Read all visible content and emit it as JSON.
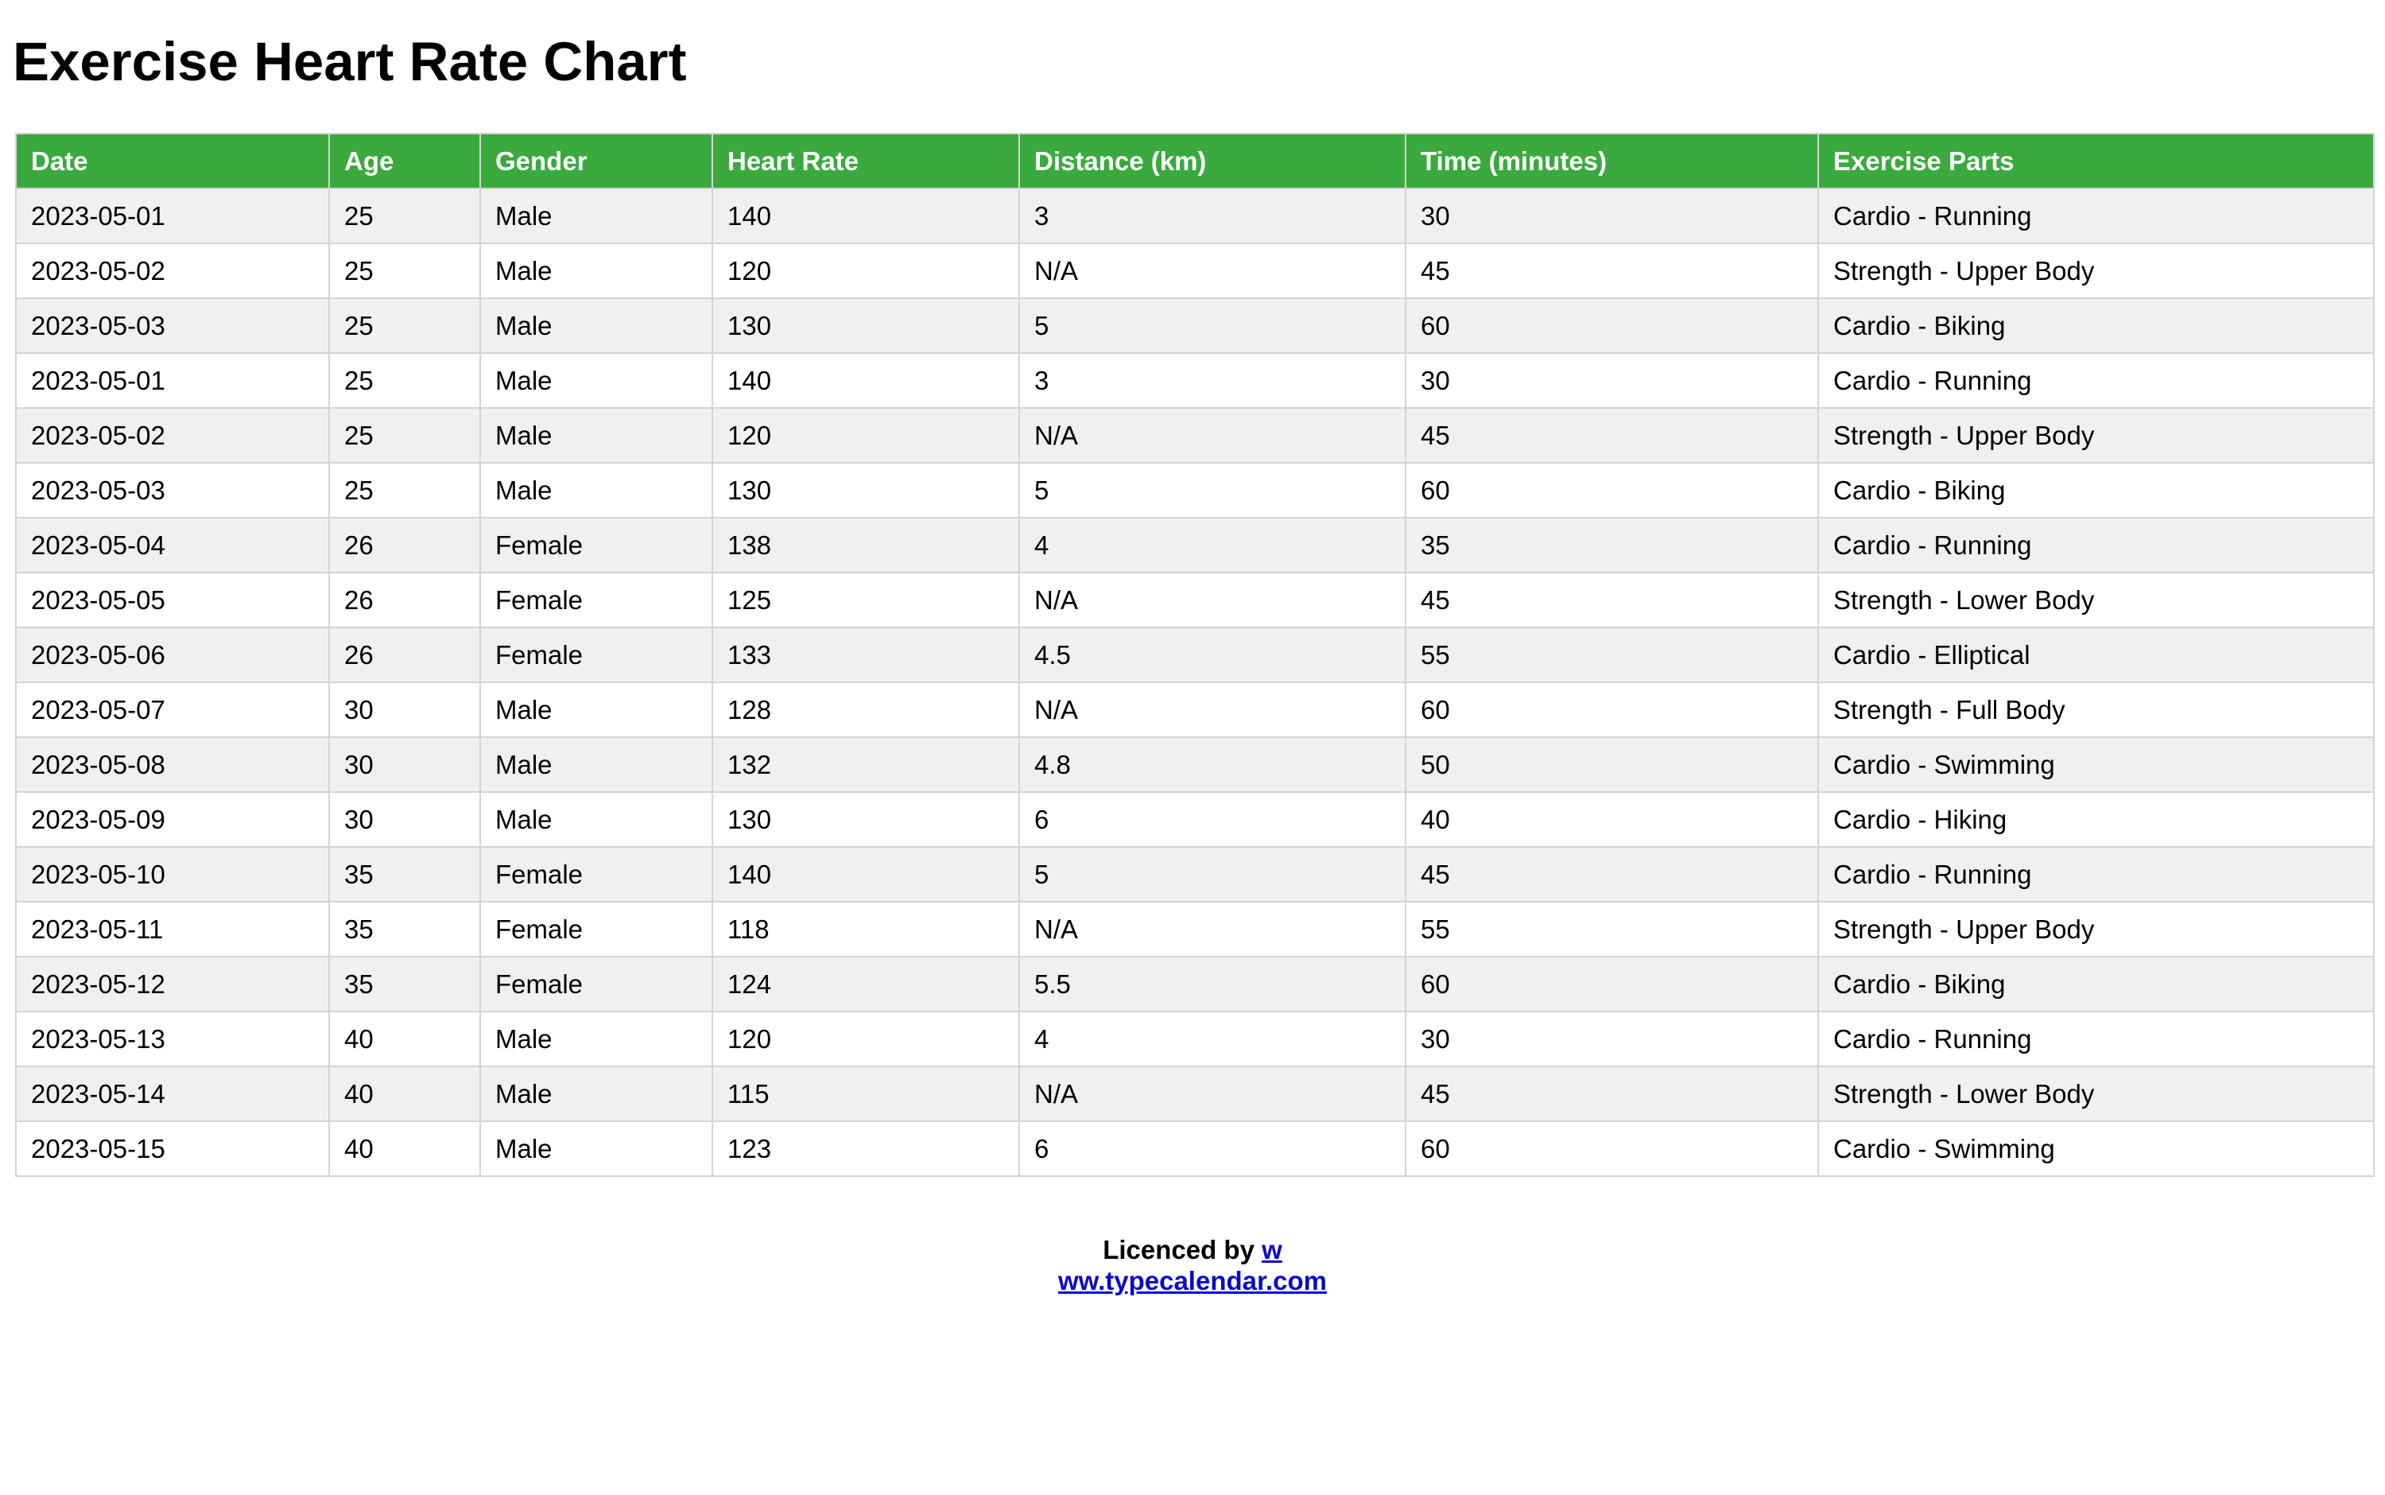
{
  "title": "Exercise Heart Rate Chart",
  "accent_color": "#3aaa3f",
  "table": {
    "headers": [
      "Date",
      "Age",
      "Gender",
      "Heart Rate",
      "Distance (km)",
      "Time (minutes)",
      "Exercise Parts"
    ],
    "rows": [
      [
        "2023-05-01",
        "25",
        "Male",
        "140",
        "3",
        "30",
        "Cardio - Running"
      ],
      [
        "2023-05-02",
        "25",
        "Male",
        "120",
        "N/A",
        "45",
        "Strength - Upper Body"
      ],
      [
        "2023-05-03",
        "25",
        "Male",
        "130",
        "5",
        "60",
        "Cardio - Biking"
      ],
      [
        "2023-05-01",
        "25",
        "Male",
        "140",
        "3",
        "30",
        "Cardio - Running"
      ],
      [
        "2023-05-02",
        "25",
        "Male",
        "120",
        "N/A",
        "45",
        "Strength - Upper Body"
      ],
      [
        "2023-05-03",
        "25",
        "Male",
        "130",
        "5",
        "60",
        "Cardio - Biking"
      ],
      [
        "2023-05-04",
        "26",
        "Female",
        "138",
        "4",
        "35",
        "Cardio - Running"
      ],
      [
        "2023-05-05",
        "26",
        "Female",
        "125",
        "N/A",
        "45",
        "Strength - Lower Body"
      ],
      [
        "2023-05-06",
        "26",
        "Female",
        "133",
        "4.5",
        "55",
        "Cardio - Elliptical"
      ],
      [
        "2023-05-07",
        "30",
        "Male",
        "128",
        "N/A",
        "60",
        "Strength - Full Body"
      ],
      [
        "2023-05-08",
        "30",
        "Male",
        "132",
        "4.8",
        "50",
        "Cardio - Swimming"
      ],
      [
        "2023-05-09",
        "30",
        "Male",
        "130",
        "6",
        "40",
        "Cardio - Hiking"
      ],
      [
        "2023-05-10",
        "35",
        "Female",
        "140",
        "5",
        "45",
        "Cardio - Running"
      ],
      [
        "2023-05-11",
        "35",
        "Female",
        "118",
        "N/A",
        "55",
        "Strength - Upper Body"
      ],
      [
        "2023-05-12",
        "35",
        "Female",
        "124",
        "5.5",
        "60",
        "Cardio - Biking"
      ],
      [
        "2023-05-13",
        "40",
        "Male",
        "120",
        "4",
        "30",
        "Cardio - Running"
      ],
      [
        "2023-05-14",
        "40",
        "Male",
        "115",
        "N/A",
        "45",
        "Strength - Lower Body"
      ],
      [
        "2023-05-15",
        "40",
        "Male",
        "123",
        "6",
        "60",
        "Cardio - Swimming"
      ]
    ]
  },
  "footer": {
    "prefix": "Licenced by ",
    "link_part1": "w",
    "link_part2": "ww.typecalendar.com"
  }
}
